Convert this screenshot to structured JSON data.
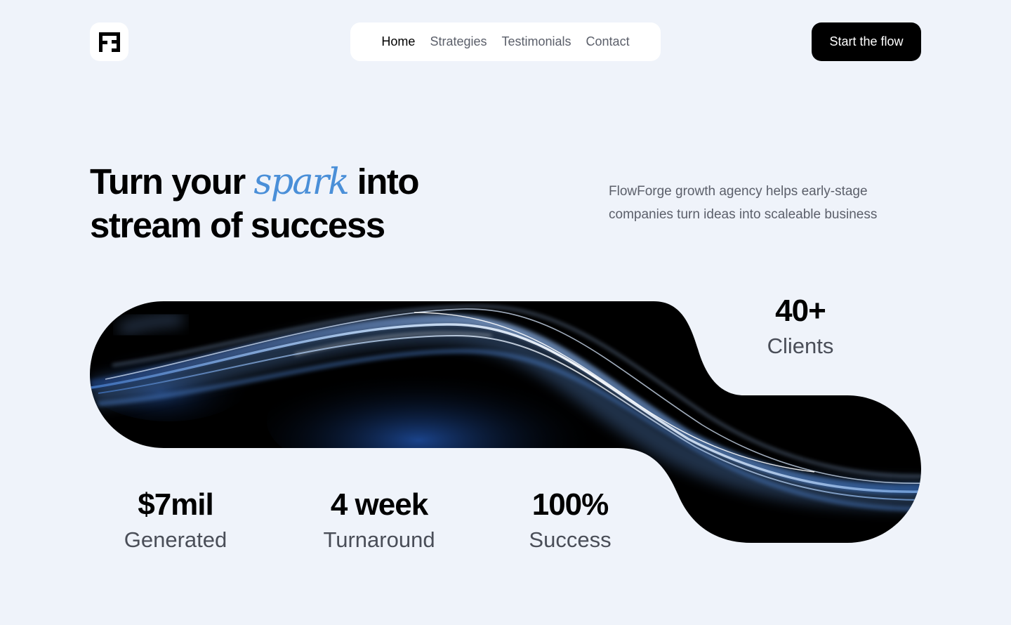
{
  "brand": {
    "logo_icon": "ff-monogram-icon"
  },
  "nav": {
    "items": [
      {
        "label": "Home",
        "active": true
      },
      {
        "label": "Strategies",
        "active": false
      },
      {
        "label": "Testimonials",
        "active": false
      },
      {
        "label": "Contact",
        "active": false
      }
    ]
  },
  "header": {
    "cta_label": "Start the flow"
  },
  "hero": {
    "headline_before": "Turn your ",
    "headline_accent": "spark",
    "headline_after_line1": " into",
    "headline_line2": "stream of success",
    "description": "FlowForge growth agency helps early-stage companies turn ideas into scaleable business"
  },
  "stats": {
    "clients": {
      "value": "40+",
      "label": "Clients"
    },
    "generated": {
      "value": "$7mil",
      "label": "Generated"
    },
    "turnaround": {
      "value": "4 week",
      "label": "Turnaround"
    },
    "success": {
      "value": "100%",
      "label": "Success"
    }
  },
  "colors": {
    "page_background": "#eff3fa",
    "accent": "#4a8fd8",
    "button_background": "#000000",
    "muted_text": "#5b5f6a"
  }
}
